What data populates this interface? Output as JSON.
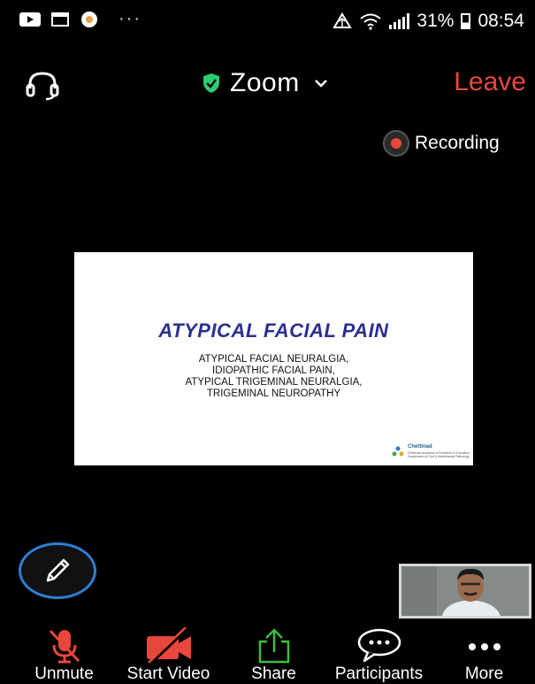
{
  "status_bar": {
    "battery": "31%",
    "time": "08:54",
    "icons": [
      "youtube-icon",
      "calendar-icon",
      "app-icon",
      "more-notifications-icon",
      "data-icon",
      "wifi-icon",
      "signal-icon",
      "battery-icon"
    ]
  },
  "top_bar": {
    "title": "Zoom",
    "leave_label": "Leave",
    "icons": [
      "headphones-icon",
      "shield-check-icon",
      "chevron-down-icon"
    ]
  },
  "recording": {
    "label": "Recording",
    "color": "#e8473d"
  },
  "slide": {
    "title": "ATYPICAL FACIAL PAIN",
    "subtitle_lines": [
      "ATYPICAL FACIAL NEURALGIA,",
      "IDIOPATHIC FACIAL PAIN,",
      "ATYPICAL TRIGEMINAL NEURALGIA,",
      "TRIGEMINAL NEUROPATHY"
    ],
    "logo": {
      "name": "Chettinad",
      "line1": "Chettinad Academy of Research & Education",
      "line2": "Department of Oral & Maxillofacial Pathology"
    },
    "title_color": "#2b2f8f"
  },
  "toolbar": {
    "items": [
      {
        "label": "Unmute",
        "icon": "microphone-muted-icon"
      },
      {
        "label": "Start Video",
        "icon": "video-off-icon"
      },
      {
        "label": "Share",
        "icon": "share-upload-icon"
      },
      {
        "label": "Participants",
        "icon": "chat-bubble-icon"
      },
      {
        "label": "More",
        "icon": "more-dots-icon"
      }
    ]
  },
  "colors": {
    "leave": "#e8473d",
    "annotate_ring": "#2f7fd6",
    "share_green": "#3cbf3c",
    "shield": "#2ecc71"
  }
}
